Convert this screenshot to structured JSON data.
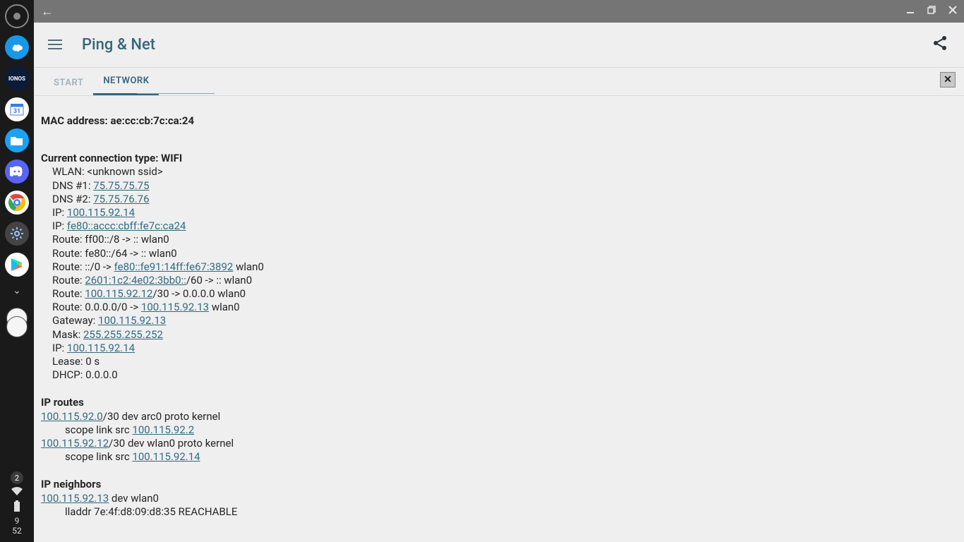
{
  "shelf": {
    "notif_count": "2",
    "clock_top": "9",
    "clock_bottom": "52"
  },
  "titlebar": {
    "back": "←"
  },
  "appbar": {
    "title": "Ping & Net"
  },
  "tabs": {
    "start": "START",
    "network": "NETWORK"
  },
  "network": {
    "mac_label": "MAC address: ",
    "mac": "ae:cc:cb:7c:ca:24",
    "conn_type_label": "Current connection type: ",
    "conn_type": "WIFI",
    "wlan_label": "WLAN: ",
    "wlan_ssid": "<unknown ssid>",
    "dns1_label": "DNS #1: ",
    "dns1": "75.75.75.75",
    "dns2_label": "DNS #2: ",
    "dns2": "75.75.76.76",
    "ip_a_label": "IP: ",
    "ip_a": "100.115.92.14",
    "ip_b_label": "IP: ",
    "ip_b": "fe80::accc:cbff:fe7c:ca24",
    "route1": "Route: ff00::/8 -> :: wlan0",
    "route2": "Route: fe80::/64 -> :: wlan0",
    "route3_pre": "Route: ::/0 -> ",
    "route3_link": "fe80::fe91:14ff:fe67:3892",
    "route3_post": " wlan0",
    "route4_pre": "Route: ",
    "route4_link": "2601:1c2:4e02:3bb0::",
    "route4_post": "/60 -> :: wlan0",
    "route5_pre": "Route: ",
    "route5_link": "100.115.92.12",
    "route5_post": "/30 -> 0.0.0.0 wlan0",
    "route6_pre": "Route: 0.0.0.0/0 -> ",
    "route6_link": "100.115.92.13",
    "route6_post": " wlan0",
    "gateway_label": "Gateway: ",
    "gateway": "100.115.92.13",
    "mask_label": "Mask: ",
    "mask": "255.255.255.252",
    "ip_c_label": "IP: ",
    "ip_c": "100.115.92.14",
    "lease": "Lease: 0 s",
    "dhcp": "DHCP: 0.0.0.0",
    "iproutes_header": "IP routes",
    "iproute1_link": "100.115.92.0",
    "iproute1_post": "/30 dev arc0 proto kernel",
    "iproute1_b_pre": "scope link src ",
    "iproute1_b_link": "100.115.92.2",
    "iproute2_link": "100.115.92.12",
    "iproute2_post": "/30 dev wlan0 proto kernel",
    "iproute2_b_pre": "scope link src ",
    "iproute2_b_link": "100.115.92.14",
    "ipneigh_header": "IP neighbors",
    "neigh1_link": "100.115.92.13",
    "neigh1_post": " dev wlan0",
    "neigh1_b": "lladdr 7e:4f:d8:09:d8:35 REACHABLE"
  }
}
